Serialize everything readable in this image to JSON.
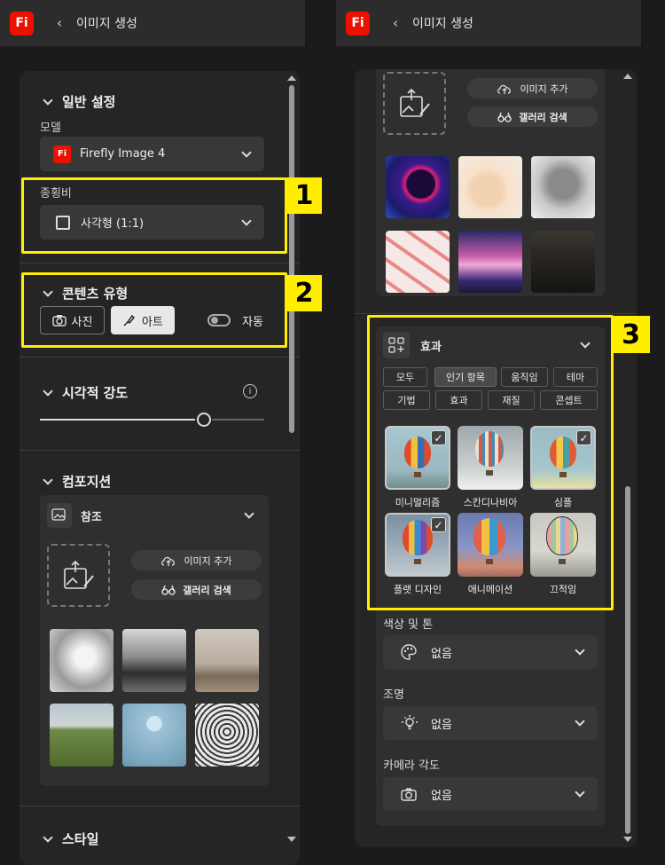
{
  "left": {
    "header": {
      "logo": "Fi",
      "back": "‹",
      "title": "이미지 생성"
    },
    "general": {
      "title": "일반 설정",
      "model_label": "모델",
      "model_value": "Firefly Image 4",
      "aspect_label": "종횡비",
      "aspect_value": "사각형 (1:1)"
    },
    "content_type": {
      "title": "콘텐츠 유형",
      "photo": "사진",
      "art": "아트",
      "auto": "자동"
    },
    "visual_intensity": {
      "title": "시각적 강도",
      "level": 0.78
    },
    "composition": {
      "title": "컴포지션",
      "reference": "참조",
      "add_image": "이미지 추가",
      "gallery_search": "갤러리 검색"
    },
    "style": {
      "title": "스타일"
    },
    "badges": {
      "one": "1",
      "two": "2"
    }
  },
  "right": {
    "header": {
      "logo": "Fi",
      "back": "‹",
      "title": "이미지 생성"
    },
    "add_image": "이미지 추가",
    "gallery_search": "갤러리 검색",
    "effects": {
      "title": "효과",
      "chips_row1": [
        "모두",
        "인기 항목",
        "움직임",
        "테마"
      ],
      "chips_row2": [
        "기법",
        "효과",
        "재질",
        "콘셉트"
      ],
      "items": [
        {
          "label": "미니멀리즘",
          "selected": true
        },
        {
          "label": "스칸디나비아",
          "selected": false
        },
        {
          "label": "심플",
          "selected": true
        },
        {
          "label": "플랫 디자인",
          "selected": true
        },
        {
          "label": "애니메이션",
          "selected": false
        },
        {
          "label": "끄적임",
          "selected": false
        }
      ],
      "check": "✓"
    },
    "color_tone": {
      "label": "색상 및 톤",
      "value": "없음"
    },
    "lighting": {
      "label": "조명",
      "value": "없음"
    },
    "camera_angle": {
      "label": "카메라 각도",
      "value": "없음"
    },
    "badge": "3"
  },
  "colors": {
    "accent_yellow": "#ffee00",
    "logo_red": "#eb1000",
    "panel": "#252525"
  }
}
